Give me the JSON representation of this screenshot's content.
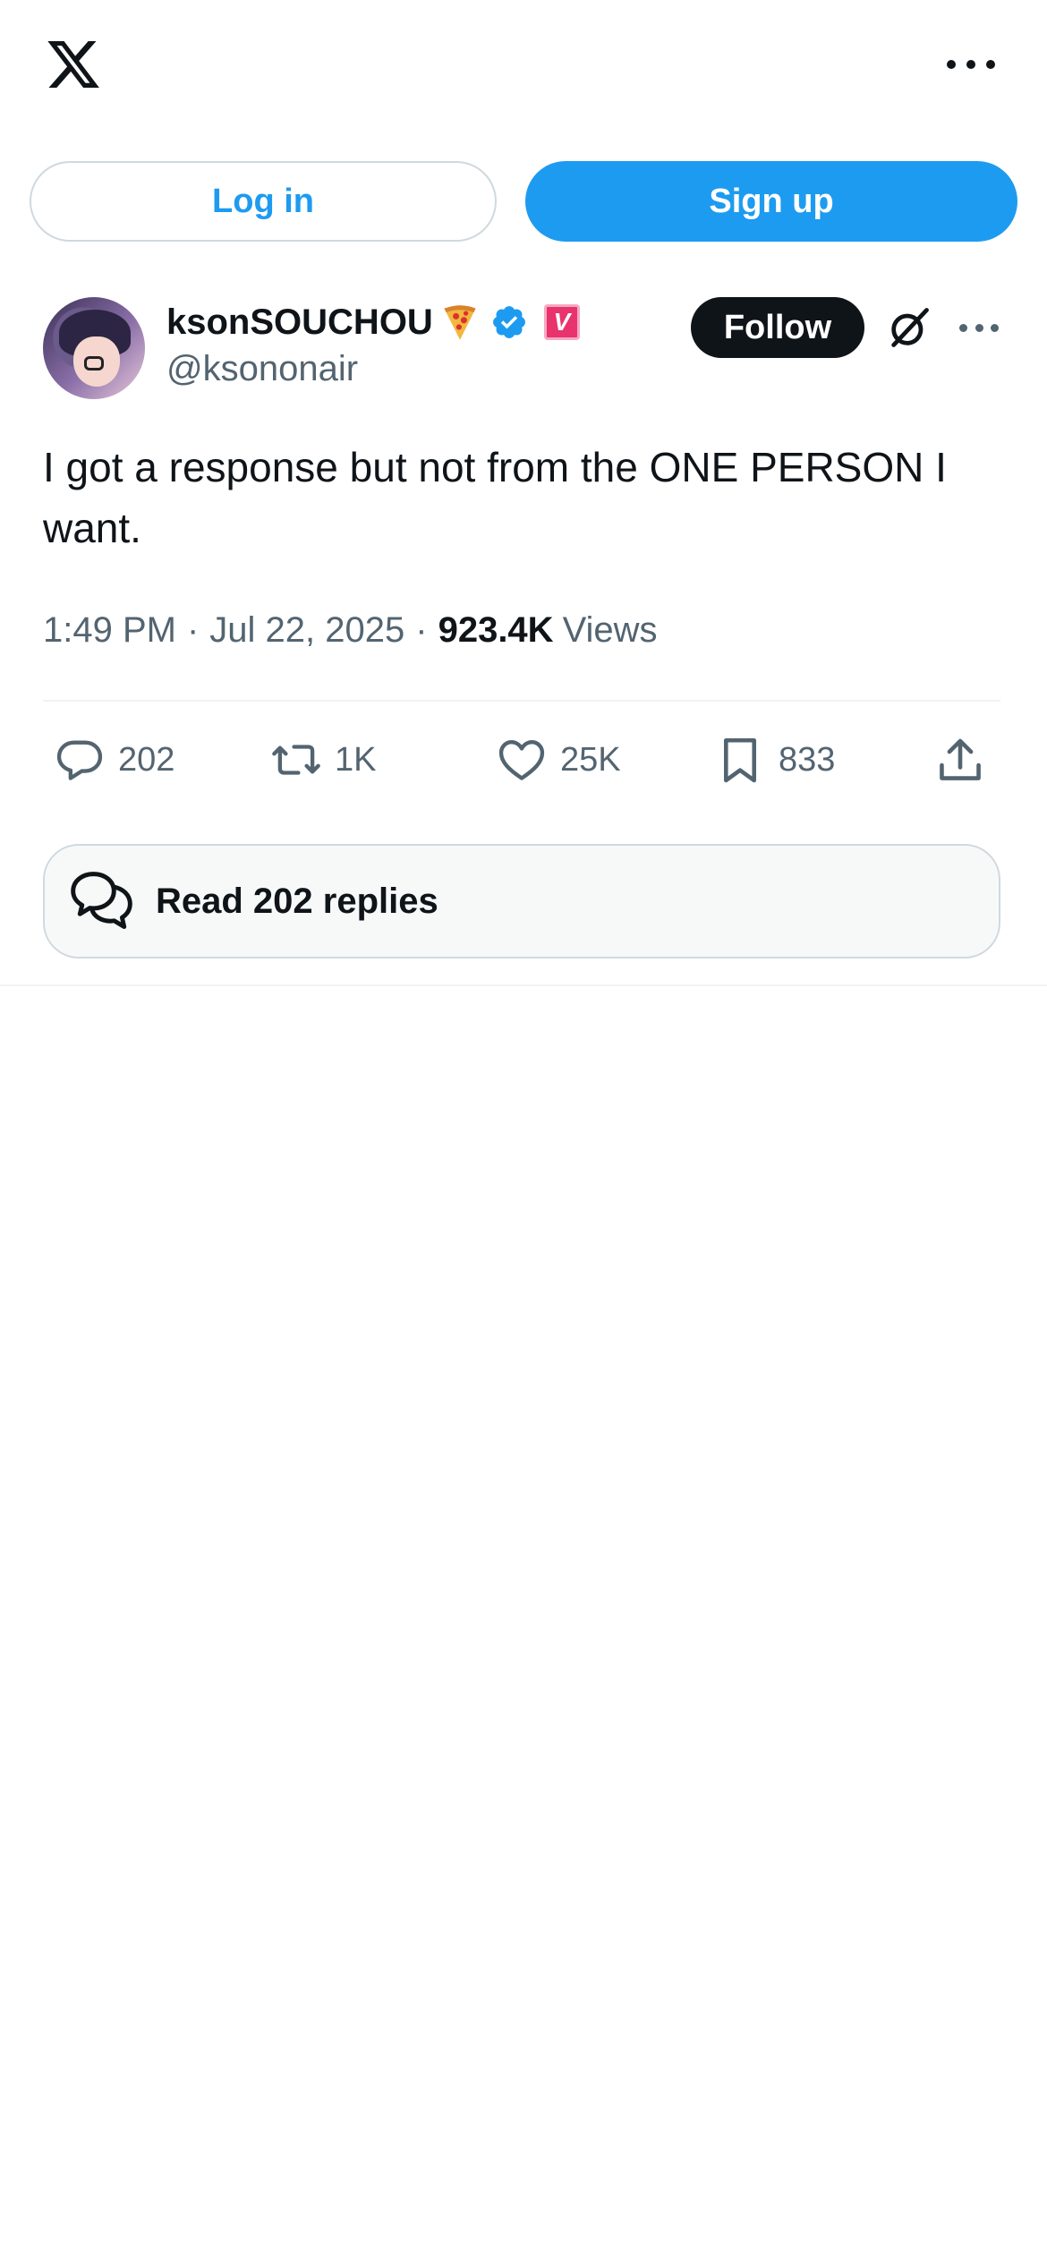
{
  "header": {
    "logo_icon": "x-logo-icon",
    "more_icon": "more-horizontal-icon"
  },
  "auth": {
    "login_label": "Log in",
    "signup_label": "Sign up",
    "accent_color": "#1d9bf0"
  },
  "author": {
    "name": "ksonSOUCHOU",
    "handle": "@ksononair",
    "badges": [
      "pizza-emoji-icon",
      "verified-icon",
      "v-badge"
    ],
    "v_badge_text": "V",
    "follow_label": "Follow",
    "grok_icon": "grok-icon",
    "more_icon": "more-horizontal-icon"
  },
  "tweet": {
    "text": "I got a response but not from the ONE PERSON I want.",
    "time": "1:49 PM",
    "date": "Jul 22, 2025",
    "views_count": "923.4K",
    "views_label": "Views"
  },
  "actions": {
    "replies": "202",
    "reposts": "1K",
    "likes": "25K",
    "bookmarks": "833"
  },
  "read_replies": {
    "label": "Read 202 replies"
  }
}
